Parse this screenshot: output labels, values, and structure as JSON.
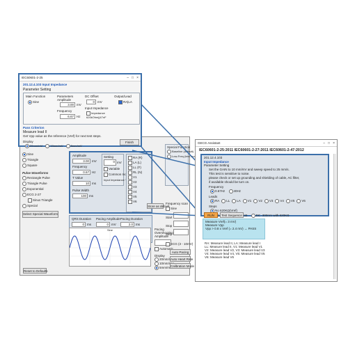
{
  "colors": {
    "accent": "#3b6faa",
    "panel": "#dde3ea",
    "highlight": "#f2a54a",
    "teal": "#b9e3ef"
  },
  "popup": {
    "title": "IEC60601-2-25",
    "heading": "201.12.4.103 Input Impedance",
    "param_title": "Parameter Setting",
    "main_function": "Main Function",
    "sine": "Sine",
    "param_amp_label": "Parameters Amplitude",
    "amp_value": "3.00",
    "amp_unit": "mV",
    "freq_label": "Frequency",
    "freq_value": "6.67",
    "freq_unit": "Hz",
    "dc_offset": "DC Offset",
    "dc_value": "0",
    "dc_unit": "mV",
    "output_lead": "Output/Lead",
    "ra_la": "RA|LA",
    "input_imp": "Input Impedance",
    "imp_opt": "Impedance 620kOhm||47nF",
    "pass_criterion": "Pass Criterion",
    "measure": "Measure lead   II",
    "get_vpp": "Get Vpp value as the reference (Vref) for next test steps.",
    "display": "Display",
    "disp1": "20mm/mV",
    "disp2": "10mm/mV",
    "disp3": "5mm/mV",
    "finish": "Finish"
  },
  "left": {
    "sine": "Sine",
    "tri": "Triangle",
    "sq": "Square",
    "pulse_title": "Pulse Waveforms",
    "p1": "Rectangle Pulse",
    "p2": "Triangle Pulse",
    "p3": "Exponential",
    "p4": "ECG 2-27",
    "p5": "Sinus Triangle",
    "p6": "Special",
    "special_btn": "Select Special Waveform",
    "reset": "Reset to Defaults"
  },
  "mid": {
    "amplitude": "Amplitude",
    "amp_v": "3.00",
    "amp_u": "mV",
    "frequency": "Frequency",
    "freq_v": "0.67",
    "freq_u": "Hz",
    "tv": "T Value",
    "tv_v": "10",
    "tv_u": "ms",
    "setting": "Setting",
    "set_v": "0",
    "set_u": "mV",
    "variable": "Variable",
    "common": "Common mode",
    "input_imp_test": "Input Impedance Test",
    "pw": "Pulse Width",
    "pw_v": "100",
    "pw_u": "ms",
    "qrs": "QRS Duration",
    "qrs_v": "0",
    "qrs_u": "ms",
    "pace_amp": "Pacing Amplitude",
    "pace_amp_v": "0",
    "pace_amp_u": "mV",
    "pace_dur": "Pacing Duration",
    "pace_dur_v": "2.0",
    "pace_dur_u": "ms",
    "twave": "T Wave",
    "tw_v": "0.20",
    "tw_u": "mV",
    "otc": "Overshoot Time Constant",
    "otc_v": "0",
    "otc_u": "ms",
    "pr": "Pacing Rate",
    "pr_v": "60",
    "pr_u": "BPM",
    "store": "Store as default",
    "pacing_title": "Pacing Overshooting Amplitude",
    "automatic": "Automatic",
    "display": "Display",
    "d1": "20mm/mV",
    "d2": "10mm/mV",
    "d3": "5mm/mV",
    "auto_pacing": "Auto Pacing",
    "auto_heart": "Auto Heart Rate",
    "calib": "Calibration Mode",
    "chart_label": "Sine"
  },
  "leads": [
    "RA (R)",
    "LA (L)",
    "LL (F)",
    "RL (N)",
    "V1",
    "V2",
    "V3",
    "V4",
    "V5",
    "V6"
  ],
  "midright": {
    "special_func": "Special Function",
    "f1": "Baseline (default)",
    "f2": "Low-Freq (test mode)",
    "freq_scan": "Frequency scan",
    "sine": "Sine",
    "start": "Start",
    "stop": "Stop",
    "step": "Step",
    "ecg3": "ECG (3 - 10mV)"
  },
  "right": {
    "title": "GECG Assistant",
    "header": "IEC60601-2-25:2011   IEC60601-2-27:2011   IEC60601-2-47:2012",
    "code": "201.12.4.103",
    "section": "Input Impedance",
    "param": "Parameter Setting",
    "l1": "Set the GAIN to 10 mm/mV and sweep speed to 25 mm/s.",
    "l2": "This test is sensitive to noise.",
    "l3": "please check or set up grounding and shielding of cable, AC filter,",
    "l4": "if available should be turn on.",
    "freq": "Frequency",
    "f1": "0.67Hz",
    "f2": "40Hz",
    "leads": "Leads",
    "lead_opts": [
      "RA",
      "LL",
      "LA",
      "V1",
      "V2",
      "V3",
      "V4",
      "V5",
      "V6"
    ],
    "steps": "Steps",
    "s1": "No 620KΩ(Vref)",
    "s2": "DC 300mV with 620KΩ",
    "s3": "DC -300mV with 620KΩ",
    "btn_run": "RUN",
    "btn_seq": "Test Sequence",
    "m1": "Measure Vref(= 3 mV)",
    "m2": "Measure Vpp",
    "m3": "Vpp > 0.8 x Vref (= 2.4 mV)  → PASS",
    "r1": "RA: Measure lead II,    LA: Measure lead I",
    "r2": "LL: Measure lead II,    V1: Measure lead V1",
    "r3": "V2: Measure lead V2,   V3: Measure lead V3",
    "r4": "V4: Measure lead V4,   V5: Measure lead V5",
    "r5": "V6: Measure lead V6"
  }
}
